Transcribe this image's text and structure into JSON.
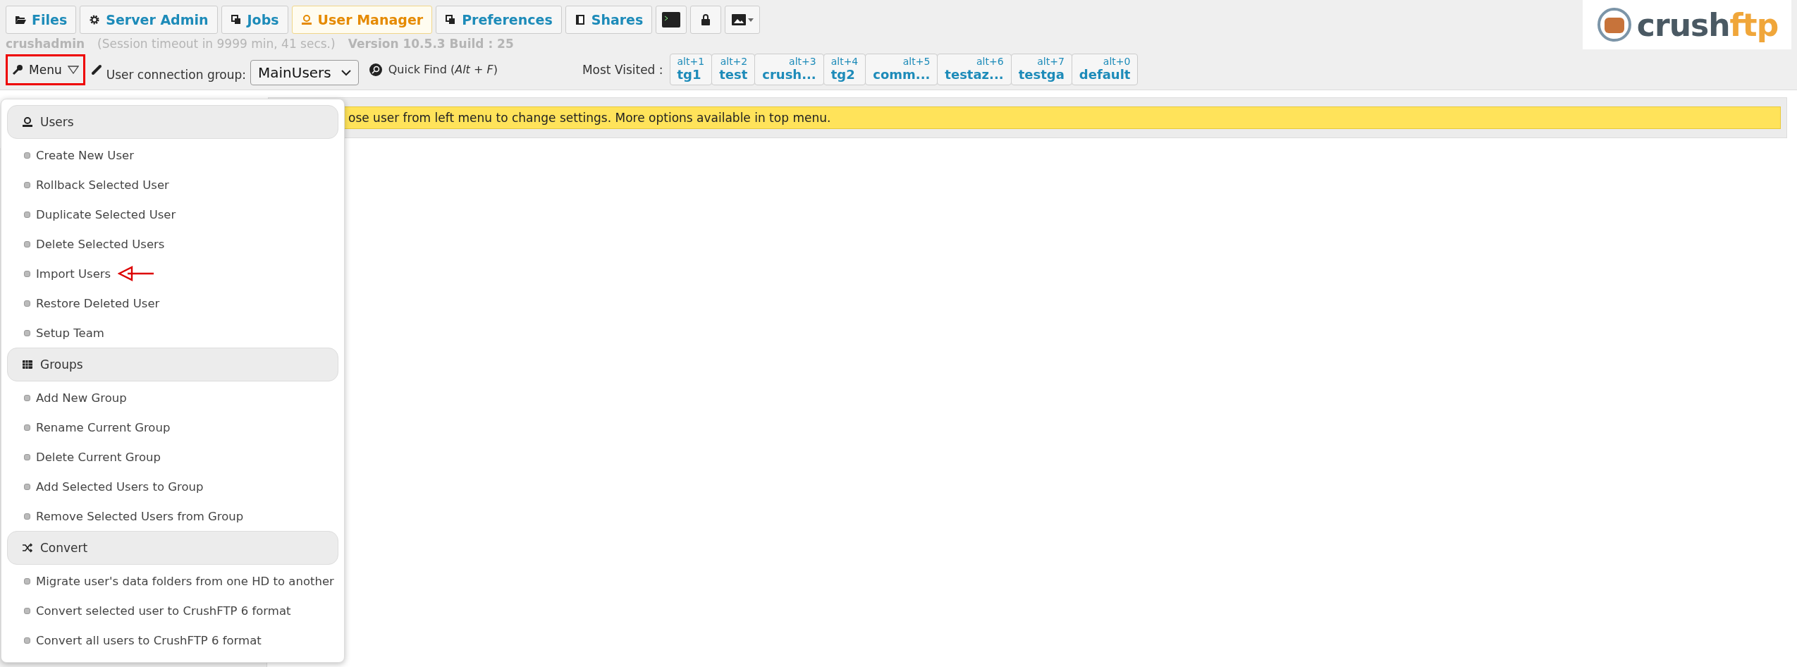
{
  "tabs": [
    {
      "label": "Files",
      "selected": false
    },
    {
      "label": "Server Admin",
      "selected": false
    },
    {
      "label": "Jobs",
      "selected": false
    },
    {
      "label": "User Manager",
      "selected": true
    },
    {
      "label": "Preferences",
      "selected": false
    },
    {
      "label": "Shares",
      "selected": false
    }
  ],
  "tool_buttons": [
    {
      "kind": "terminal"
    },
    {
      "kind": "lock"
    },
    {
      "kind": "image-dropdown"
    }
  ],
  "logo": {
    "part_1": "crush",
    "part_2": "ftp"
  },
  "session": {
    "user": "crushadmin",
    "timeout": "(Session timeout in 9999 min, 41 secs.)",
    "version": "Version 10.5.3 Build : 25"
  },
  "toolbar": {
    "menu_label": "Menu",
    "menu_expanded": true,
    "group_label": "User connection group:",
    "group_value": "MainUsers",
    "quick_find": "Quick Find (*Alt* + *F*)"
  },
  "most_visited": {
    "label": "Most Visited :",
    "items": [
      {
        "shortcut": "alt+1",
        "name": "tg1"
      },
      {
        "shortcut": "alt+2",
        "name": "test"
      },
      {
        "shortcut": "alt+3",
        "name": "crush..."
      },
      {
        "shortcut": "alt+4",
        "name": "tg2"
      },
      {
        "shortcut": "alt+5",
        "name": "comm..."
      },
      {
        "shortcut": "alt+6",
        "name": "testaz..."
      },
      {
        "shortcut": "alt+7",
        "name": "testga"
      },
      {
        "shortcut": "alt+0",
        "name": "default"
      }
    ]
  },
  "banner": {
    "text": "ose user from left menu to change settings. More options available in top menu."
  },
  "menu": {
    "sections": [
      {
        "kind": "users",
        "title": "Users",
        "items": [
          {
            "label": "Create New User",
            "annotated": false
          },
          {
            "label": "Rollback Selected User",
            "annotated": false
          },
          {
            "label": "Duplicate Selected User",
            "annotated": false
          },
          {
            "label": "Delete Selected Users",
            "annotated": false
          },
          {
            "label": "Import Users",
            "annotated": true
          },
          {
            "label": "Restore Deleted User",
            "annotated": false
          },
          {
            "label": "Setup Team",
            "annotated": false
          }
        ]
      },
      {
        "kind": "groups",
        "title": "Groups",
        "items": [
          {
            "label": "Add New Group",
            "annotated": false
          },
          {
            "label": "Rename Current Group",
            "annotated": false
          },
          {
            "label": "Delete Current Group",
            "annotated": false
          },
          {
            "label": "Add Selected Users to Group",
            "annotated": false
          },
          {
            "label": "Remove Selected Users from Group",
            "annotated": false
          }
        ]
      },
      {
        "kind": "convert",
        "title": "Convert",
        "items": [
          {
            "label": "Migrate user's data folders from one HD to another",
            "annotated": false
          },
          {
            "label": "Convert selected user to CrushFTP 6 format",
            "annotated": false
          },
          {
            "label": "Convert all users to CrushFTP 6 format",
            "annotated": false
          }
        ]
      }
    ]
  }
}
